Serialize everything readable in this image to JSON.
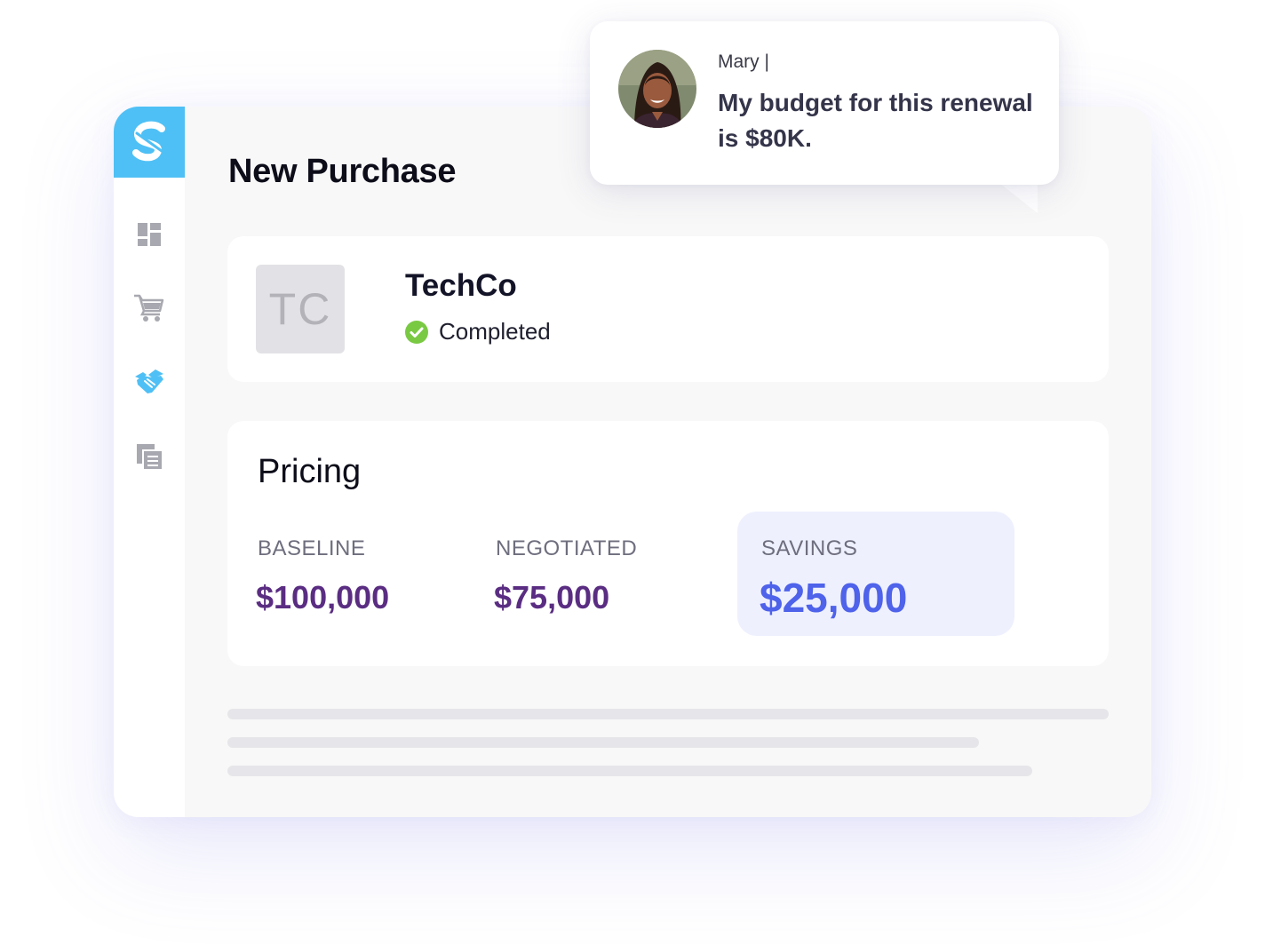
{
  "app": {
    "logo_letter": "S",
    "brand_color": "#4fc0f5"
  },
  "sidebar": {
    "items": [
      {
        "icon": "dashboard-icon",
        "active": false
      },
      {
        "icon": "cart-icon",
        "active": false
      },
      {
        "icon": "handshake-icon",
        "active": true
      },
      {
        "icon": "documents-icon",
        "active": false
      }
    ]
  },
  "page": {
    "title": "New Purchase"
  },
  "vendor": {
    "initials": "TC",
    "name": "TechCo",
    "status": "Completed",
    "status_color": "#7ac943"
  },
  "pricing": {
    "title": "Pricing",
    "baseline_label": "BASELINE",
    "baseline_value": "$100,000",
    "negotiated_label": "NEGOTIATED",
    "negotiated_value": "$75,000",
    "savings_label": "SAVINGS",
    "savings_value": "$25,000",
    "value_color": "#5a2d82",
    "savings_color": "#4e62ea"
  },
  "chat": {
    "sender": "Mary  |",
    "message": "My budget for this renewal is $80K."
  }
}
